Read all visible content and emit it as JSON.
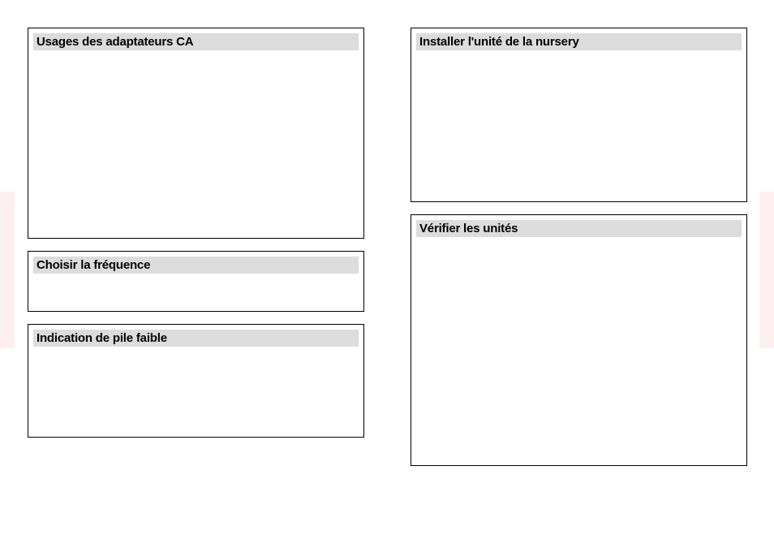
{
  "left_column": {
    "boxes": [
      {
        "title": "Usages des adaptateurs CA"
      },
      {
        "title": "Choisir la fréquence"
      },
      {
        "title": "Indication de pile faible"
      }
    ]
  },
  "right_column": {
    "boxes": [
      {
        "title": "Installer l'unité de la nursery"
      },
      {
        "title": "Vérifier les unités"
      }
    ]
  }
}
